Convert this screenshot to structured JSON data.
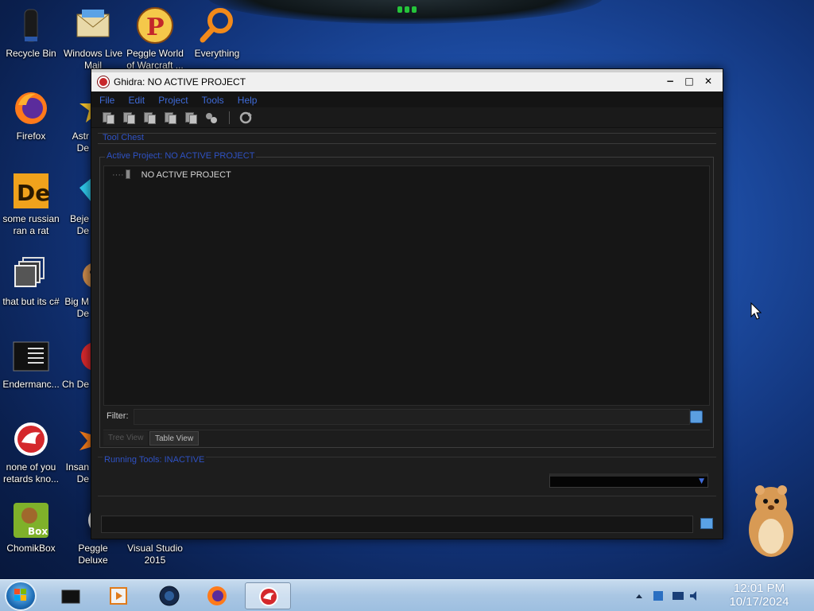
{
  "desktop": {
    "icons": [
      {
        "label": "Recycle Bin",
        "icon": "recycle-bin-icon"
      },
      {
        "label": "Windows Live Mail",
        "icon": "mail-icon"
      },
      {
        "label": "Peggle World of Warcraft ...",
        "icon": "peggle-icon"
      },
      {
        "label": "Everything",
        "icon": "search-icon"
      },
      {
        "label": "Firefox",
        "icon": "firefox-icon"
      },
      {
        "label": "Astr De",
        "icon": "star-icon"
      },
      {
        "label": "some russian ran a rat",
        "icon": "de-icon"
      },
      {
        "label": "Beje De",
        "icon": "gem-icon"
      },
      {
        "label": "that but its c#",
        "icon": "copy-icon"
      },
      {
        "label": "Big M De",
        "icon": "character-icon"
      },
      {
        "label": "Endermanc...",
        "icon": "terminal-icon"
      },
      {
        "label": "Ch De",
        "icon": "app-icon"
      },
      {
        "label": "none of you retards kno...",
        "icon": "ghidra-icon"
      },
      {
        "label": "Insan De",
        "icon": "burst-icon"
      },
      {
        "label": "ChomikBox",
        "icon": "chomikbox-icon"
      },
      {
        "label": "Peggle Deluxe",
        "icon": "peggle-deluxe-icon"
      },
      {
        "label": "Visual Studio 2015",
        "icon": "visual-studio-icon"
      }
    ]
  },
  "window": {
    "title": "Ghidra: NO ACTIVE PROJECT",
    "controls": {
      "minimize": "−",
      "maximize": "□",
      "close": "✕"
    },
    "menu": [
      "File",
      "Edit",
      "Project",
      "Tools",
      "Help"
    ],
    "toolbar_icons": [
      "new-project-icon",
      "open-project-icon",
      "close-project-icon",
      "save-project-icon",
      "delete-project-icon",
      "link-icon",
      "refresh-icon"
    ],
    "tool_chest": {
      "label": "Tool Chest"
    },
    "active_project": {
      "label": "Active Project: NO ACTIVE PROJECT",
      "tree_root": "NO ACTIVE PROJECT",
      "filter_label": "Filter:",
      "filter_value": "",
      "tabs": [
        "Tree View",
        "Table View"
      ]
    },
    "running_tools": {
      "label": "Running Tools: INACTIVE",
      "selected": ""
    },
    "status_text": ""
  },
  "taskbar": {
    "apps": [
      "file-explorer-icon",
      "media-player-icon",
      "globe-icon",
      "firefox-icon",
      "ghidra-icon"
    ],
    "active_app": "ghidra-icon",
    "time": "12:01 PM",
    "date": "10/17/2024"
  },
  "colors": {
    "menu_text": "#3f6bd9",
    "panel_label": "#2f52c4",
    "window_bg": "#1d1d1d"
  }
}
